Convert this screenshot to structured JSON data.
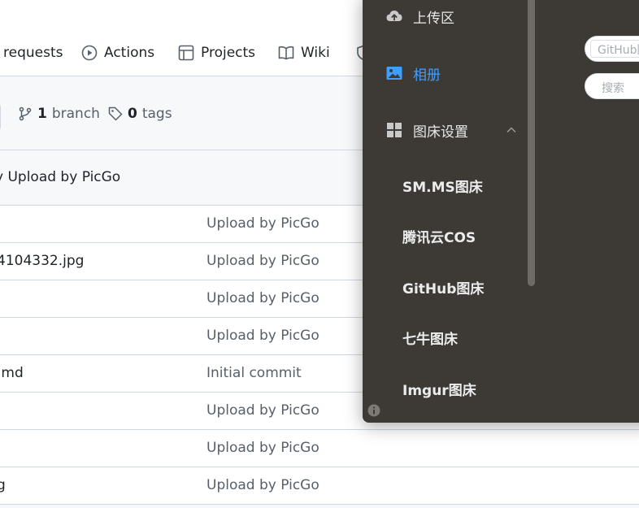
{
  "github": {
    "nav_tabs": [
      {
        "label": "requests",
        "icon": "pull-request-icon"
      },
      {
        "label": "Actions",
        "icon": "play-circle-icon"
      },
      {
        "label": "Projects",
        "icon": "table-icon"
      },
      {
        "label": "Wiki",
        "icon": "book-icon"
      }
    ],
    "branches": {
      "count": "1",
      "label": "branch"
    },
    "tags": {
      "count": "0",
      "label": "tags"
    },
    "latest_commit": "y Upload by PicGo",
    "files": [
      {
        "name": "",
        "message": "Upload by PicGo"
      },
      {
        "name": "4104332.jpg",
        "message": "Upload by PicGo"
      },
      {
        "name": "",
        "message": "Upload by PicGo"
      },
      {
        "name": "",
        "message": "Upload by PicGo"
      },
      {
        "name": ".md",
        "message": "Initial commit"
      },
      {
        "name": "",
        "message": "Upload by PicGo"
      },
      {
        "name": "",
        "message": "Upload by PicGo"
      },
      {
        "name": "g",
        "message": "Upload by PicGo"
      }
    ]
  },
  "picgo": {
    "menu": [
      {
        "label": "上传区",
        "icon": "cloud-upload-icon"
      },
      {
        "label": "相册",
        "icon": "image-icon",
        "active": true
      },
      {
        "label": "图床设置",
        "icon": "grid-icon",
        "expanded": true
      }
    ],
    "submenu": [
      "SM.MS图床",
      "腾讯云COS",
      "GitHub图床",
      "七牛图床",
      "Imgur图床"
    ],
    "filter_select_value": "GitHub图床",
    "search_placeholder": "搜索",
    "colors": {
      "sidebar_bg": "#3d3a35",
      "active": "#409eff"
    }
  }
}
